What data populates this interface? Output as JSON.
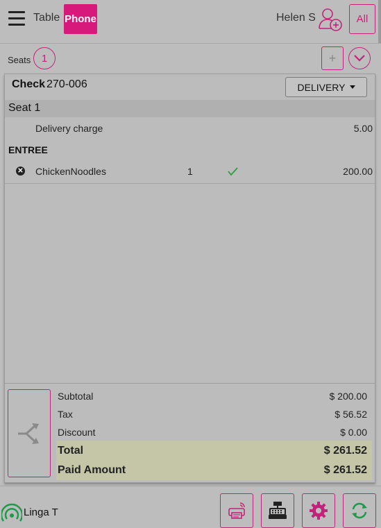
{
  "header": {
    "tab_table": "Table",
    "tab_phone": "Phone",
    "user_name": "Helen S",
    "all_label": "All"
  },
  "seats": {
    "label": "Seats",
    "count": "1",
    "add_label": "+"
  },
  "check": {
    "title": "Check",
    "number": "270-006",
    "order_type": "DELIVERY",
    "seat_label": "Seat 1",
    "delivery_charge": {
      "name": "Delivery charge",
      "amount": "5.00"
    },
    "category": "ENTREE",
    "items": [
      {
        "name": "ChickenNoodles",
        "qty": "1",
        "amount": "200.00",
        "sent": true
      }
    ]
  },
  "totals": {
    "subtotal_label": "Subtotal",
    "subtotal": "$ 200.00",
    "tax_label": "Tax",
    "tax": "$ 56.52",
    "discount_label": "Discount",
    "discount": "$ 0.00",
    "total_label": "Total",
    "total": "$ 261.52",
    "paid_label": "Paid Amount",
    "paid": "$ 261.52"
  },
  "footer": {
    "device_name": "Linga T"
  },
  "colors": {
    "accent": "#c2237a",
    "phone_tab": "#d6197a",
    "check_green": "#2e9e3e",
    "sync_green": "#1d9a4a",
    "highlight": "#c4c6a7"
  },
  "icons": [
    "menu-icon",
    "add-user-icon",
    "chevron-down-icon",
    "remove-icon",
    "check-icon",
    "split-icon",
    "signal-icon",
    "printer-icon",
    "cash-register-icon",
    "gear-icon",
    "sync-icon"
  ]
}
